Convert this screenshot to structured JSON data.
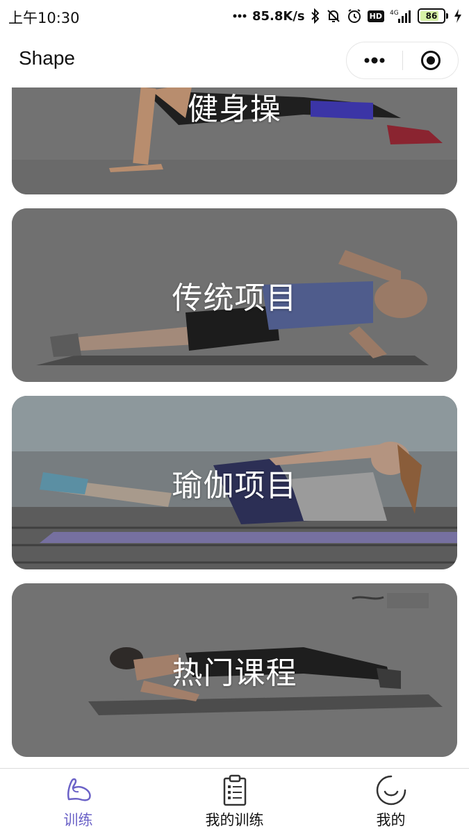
{
  "status_bar": {
    "time": "上午10:30",
    "network_speed": "85.8K/s",
    "hd_badge": "HD",
    "signal_type": "4G",
    "battery_level": "86"
  },
  "nav": {
    "title": "Shape"
  },
  "cards": [
    {
      "label": "健身操"
    },
    {
      "label": "传统项目"
    },
    {
      "label": "瑜伽项目"
    },
    {
      "label": "热门课程"
    }
  ],
  "tabs": [
    {
      "label": "训练",
      "icon": "muscle-arm-icon",
      "active": true
    },
    {
      "label": "我的训练",
      "icon": "clipboard-checklist-icon",
      "active": false
    },
    {
      "label": "我的",
      "icon": "smile-circle-icon",
      "active": false
    }
  ],
  "colors": {
    "active_tab": "#6b62c7",
    "card_overlay": "#6f6f6f"
  }
}
